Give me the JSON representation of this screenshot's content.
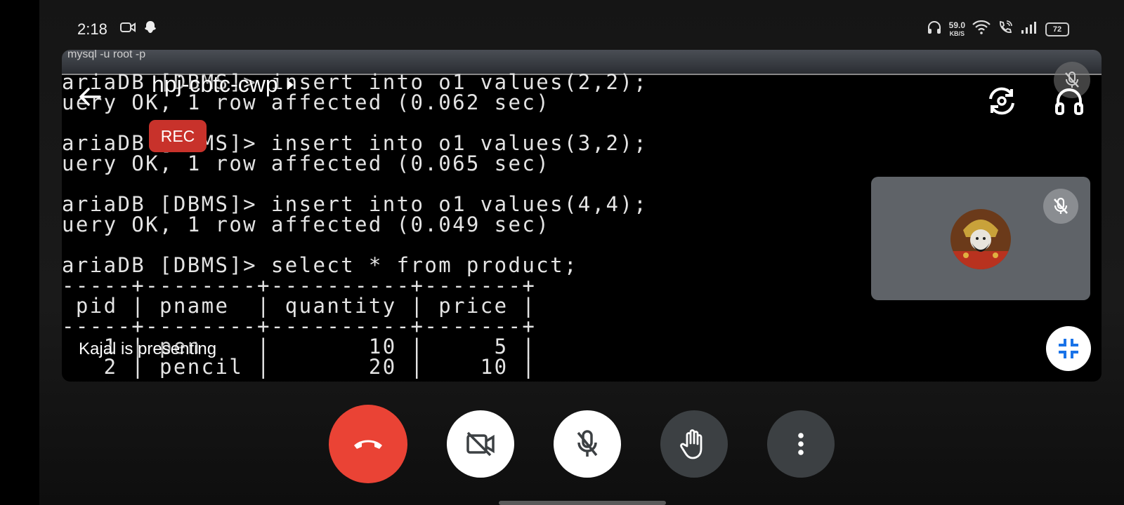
{
  "status_bar": {
    "time": "2:18",
    "net_speed_value": "59.0",
    "net_speed_unit": "KB/S",
    "battery": "72",
    "icons": [
      "video-camera-icon",
      "snapchat-icon",
      "headphones-icon",
      "wifi-icon",
      "wifi-call-icon",
      "signal-icon",
      "battery-icon"
    ]
  },
  "meeting": {
    "title": "hpj-cbtc-cwp",
    "rec_badge": "REC",
    "presenting_label": "Kajal is presenting"
  },
  "shared_screen": {
    "window_title": "mysql  -u root -p",
    "terminal_lines": [
      "ariaDB [DBMS]> insert into o1 values(2,2);",
      "uery OK, 1 row affected (0.062 sec)",
      "",
      "ariaDB [DBMS]> insert into o1 values(3,2);",
      "uery OK, 1 row affected (0.065 sec)",
      "",
      "ariaDB [DBMS]> insert into o1 values(4,4);",
      "uery OK, 1 row affected (0.049 sec)",
      "",
      "ariaDB [DBMS]> select * from product;",
      "-----+--------+----------+-------+",
      " pid | pname  | quantity | price |",
      "-----+--------+----------+-------+",
      "   1 | pen    |       10 |     5 |",
      "   2 | pencil |       20 |    10 |"
    ]
  },
  "controls": {
    "end_call": "end-call-icon",
    "camera": "camera-off-icon",
    "mic": "mic-off-icon",
    "raise_hand": "hand-icon",
    "more": "more-vert-icon"
  },
  "colors": {
    "end_call_red": "#ea4335",
    "rec_red": "#c8322b",
    "tile_gray": "#5f6368",
    "control_dark": "#3c4043",
    "minimize_blue": "#1a73e8"
  }
}
